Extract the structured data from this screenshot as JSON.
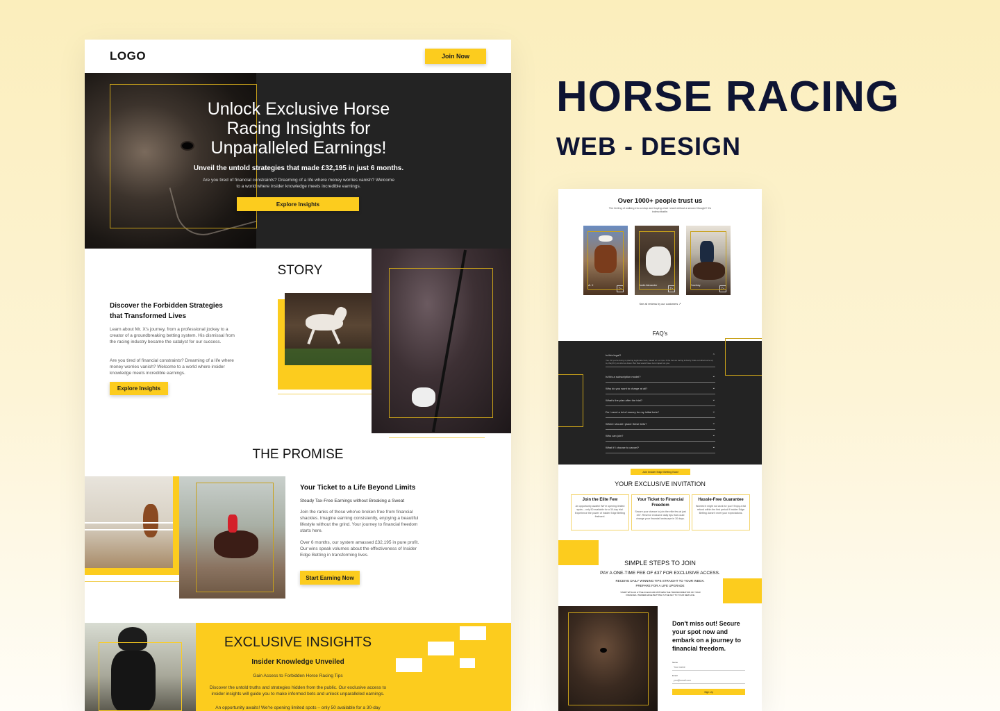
{
  "presentation": {
    "title": "HORSE RACING",
    "subtitle": "WEB - DESIGN"
  },
  "header": {
    "logo": "LOGO",
    "join_label": "Join Now"
  },
  "hero": {
    "title": "Unlock Exclusive Horse Racing Insights for Unparalleled Earnings!",
    "subtitle": "Unveil the untold strategies that made £32,195 in just 6 months.",
    "description": "Are you tired of financial constraints? Dreaming of a life where money worries vanish? Welcome to a world where insider knowledge meets incredible earnings.",
    "cta": "Explore Insights"
  },
  "story": {
    "title": "STORY",
    "heading": "Discover the Forbidden Strategies that Transformed Lives",
    "p1": "Learn about Mr. X's journey, from a professional jockey to a creator of a groundbreaking betting system. His dismissal from the racing industry became the catalyst for our success.",
    "p2": "Are you tired of financial constraints? Dreaming of a life where money worries vanish? Welcome to a world where insider knowledge meets incredible earnings.",
    "cta": "Explore Insights"
  },
  "promise": {
    "title": "THE PROMISE",
    "heading": "Your Ticket to a Life Beyond Limits",
    "tagline": "Steady Tax-Free Earnings without Breaking a Sweat",
    "p1": "Join the ranks of those who've broken free from financial shackles. Imagine earning consistently, enjoying a beautiful lifestyle without the grind. Your journey to financial freedom starts here.",
    "p2": "Over 6 months, our system amassed £32,195 in pure profit. Our wins speak volumes about the effectiveness of Insider Edge Betting in transforming lives.",
    "cta": "Start Earning Now"
  },
  "exclusive": {
    "title": "EXCLUSIVE INSIGHTS",
    "heading": "Insider Knowledge Unveiled",
    "tagline": "Gain Access to Forbidden Horse Racing Tips",
    "p1": "Discover the untold truths and strategies hidden from the public. Our exclusive access to insider insights will guide you to make informed bets and unlock unparalleled earnings.",
    "p2": "An opportunity awaits! We're opening limited spots – only 50 available for a 30-day"
  },
  "trust": {
    "title": "Over 1000+ people trust us",
    "subtitle": "The feeling of walking into a shop and buying what I want without a second thought? It's indescribable.",
    "people": [
      {
        "name": "Mr. X"
      },
      {
        "name": "Justin Alexander"
      },
      {
        "name": "Courtney"
      }
    ],
    "link": "See all reviews by our customers"
  },
  "faq": {
    "title": "FAQ's",
    "open_question": "Is this legal?",
    "open_answer": "Yes. All you're doing is placing legitimate bets, based on our tips. If the bet we racing industry finds out what we're up to, they'll try to shut us down. But that would have zero impact on you.",
    "items": [
      "Is this a subscription model?",
      "Why do you want to charge at all?",
      "What's the plan after the trial?",
      "Do I need a lot of money for my initial bets?",
      "Where should I place these bets?",
      "Who can join?",
      "What if I choose to cancel?"
    ],
    "cta": "Join Insider Edge Betting Now!"
  },
  "invitation": {
    "title": "YOUR EXCLUSIVE INVITATION",
    "cards": [
      {
        "title": "Join the Elite Few",
        "text": "An opportunity awaits! We're opening limited spots – only 50 available for a 30-day trial. Experience the power of Insider Edge Betting firsthand."
      },
      {
        "title": "Your Ticket to Financial Freedom",
        "text": "Secure your chance to join the elite few at just £37. Reserve exclusive daily tips that could change your financial landscape in 30 days."
      },
      {
        "title": "Hassle-Free Guarantee",
        "text": "Worried it might not work for you? Enjoy a full refund within the first period if Insider Edge Betting doesn't meet your expectations."
      }
    ]
  },
  "steps": {
    "title": "SIMPLE STEPS TO JOIN",
    "line1": "PAY A ONE-TIME FEE OF £37 FOR EXCLUSIVE ACCESS.",
    "line2": "RECEIVE DAILY WINNING TIPS STRAIGHT TO YOUR INBOX.",
    "line3": "PREPARE FOR A LIFE UPGRADE",
    "line4": "START WITH AS LITTLE AS £10 AND WITNESS THE TRANSFORMATION OF YOUR FINANCES. INSIDER EDGE BETTING IS THE KEY TO YOUR NEW LIFE."
  },
  "signup": {
    "heading": "Don't miss out! Secure your spot now and embark on a journey to financial freedom.",
    "name_label": "Name",
    "name_placeholder": "Your name",
    "email_label": "Email",
    "email_placeholder": "you@email.com",
    "button": "Sign Up"
  },
  "colors": {
    "accent": "#fccc1e",
    "dark": "#232323",
    "title": "#0e1433"
  }
}
